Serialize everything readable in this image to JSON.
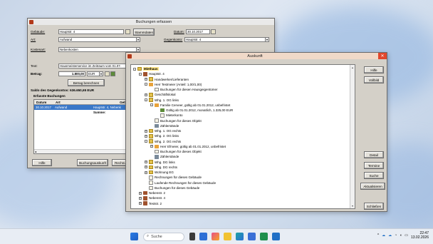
{
  "win1": {
    "title": "Buchungen erfassen",
    "fields": {
      "gebaeude_label": "Gebäude:",
      "gebaeude_value": "Hauptstr. 4",
      "stammdaten_btn": "Stammdaten",
      "datum_label": "Datum:",
      "datum_value": "30.10.2017",
      "art_label": "Art:",
      "art_value": "Aufwand",
      "gegenkonto_label": "Gegenkonto:",
      "gegenkonto_value": "Hauptstr. 4",
      "kostenart_label": "Kostenart:",
      "kostenart_value": "Nebenkosten",
      "text_label": "Text:",
      "text_value": "Hausmeisterservice im Zeitraum vom 01.07.",
      "betrag_label": "Betrag:",
      "betrag_value": "1.800,00",
      "currency": "EUR",
      "betrag_berechnen_btn": "Betrag berechnen",
      "saldo_text": "Saldo des Gegenkontos: 636.650,65 EUR"
    },
    "erfasste": {
      "heading": "Erfasste Buchungen",
      "columns": [
        "Datum",
        "Art",
        "Geb"
      ],
      "rows": [
        {
          "datum": "30.10.2017",
          "art": "Aufwand",
          "geb": "Hauptstr. 4, Nebenk"
        }
      ],
      "summe_label": "Summe:"
    },
    "buttons": {
      "hilfe": "Hilfe",
      "buchungsauskunft": "Buchungsauskunft",
      "rechnung": "Rechnu"
    }
  },
  "win2": {
    "title": "Auskunft",
    "tree": [
      {
        "depth": 0,
        "exp": "-",
        "icon": "folder",
        "label": "Miethaus",
        "highlight": true
      },
      {
        "depth": 1,
        "exp": "-",
        "icon": "house",
        "label": "Hauptstr. 4"
      },
      {
        "depth": 2,
        "exp": "+",
        "icon": "folder",
        "label": "Handwerker/Lieferanten"
      },
      {
        "depth": 2,
        "exp": "-",
        "icon": "person",
        "label": "Herr Testmeier (Anteil: 1,00/1,00)"
      },
      {
        "depth": 3,
        "exp": "",
        "icon": "doc",
        "label": "Buchungen für diesen Hausgeigentümer"
      },
      {
        "depth": 2,
        "exp": "+",
        "icon": "folder",
        "label": "Geschäftslokal"
      },
      {
        "depth": 2,
        "exp": "-",
        "icon": "folder",
        "label": "Whg. 1. OG links"
      },
      {
        "depth": 3,
        "exp": "-",
        "icon": "person",
        "label": "Familie Cerveer, gültig ab 01.01.2012, unbefristet"
      },
      {
        "depth": 4,
        "exp": "",
        "icon": "pen",
        "label": "Gültig ab 01.01.2012, monatlich, 1.325,00 EUR"
      },
      {
        "depth": 4,
        "exp": "",
        "icon": "doc",
        "label": "Mieterkonto"
      },
      {
        "depth": 3,
        "exp": "",
        "icon": "doc",
        "label": "Buchungen für dieses Objekt"
      },
      {
        "depth": 3,
        "exp": "",
        "icon": "meter",
        "label": "Zählerstände"
      },
      {
        "depth": 2,
        "exp": "+",
        "icon": "folder",
        "label": "Whg. 1. OG rechts"
      },
      {
        "depth": 2,
        "exp": "+",
        "icon": "folder",
        "label": "Whg. 2. OG links"
      },
      {
        "depth": 2,
        "exp": "-",
        "icon": "folder",
        "label": "Whg. 2. OG rechts"
      },
      {
        "depth": 3,
        "exp": "+",
        "icon": "person",
        "label": "Herr Efmeier, gültig ab 01.01.2012, unbefristet"
      },
      {
        "depth": 3,
        "exp": "",
        "icon": "doc",
        "label": "Buchungen für dieses Objekt"
      },
      {
        "depth": 3,
        "exp": "",
        "icon": "meter",
        "label": "Zählerstände"
      },
      {
        "depth": 2,
        "exp": "+",
        "icon": "folder",
        "label": "Whg. DG links"
      },
      {
        "depth": 2,
        "exp": "+",
        "icon": "folder",
        "label": "Whg. DG rechts"
      },
      {
        "depth": 2,
        "exp": "+",
        "icon": "folder",
        "label": "Wohnung EG"
      },
      {
        "depth": 2,
        "exp": "",
        "icon": "doc",
        "label": "Rechnungen für dieses Gebäude"
      },
      {
        "depth": 2,
        "exp": "",
        "icon": "doc",
        "label": "Laufende Rechnungen für dieses Gebäude"
      },
      {
        "depth": 2,
        "exp": "",
        "icon": "doc",
        "label": "Buchungen für dieses Gebäude"
      },
      {
        "depth": 1,
        "exp": "+",
        "icon": "house",
        "label": "Nebenstr. 2"
      },
      {
        "depth": 1,
        "exp": "+",
        "icon": "house",
        "label": "Nebenstr. 4"
      },
      {
        "depth": 1,
        "exp": "+",
        "icon": "house",
        "label": "Teststr. 2"
      }
    ],
    "buttons": {
      "hilfe": "Hilfe",
      "vollbild": "Vollbild",
      "detail": "Detail",
      "termine": "Termine",
      "suche": "Suche",
      "aktualisieren": "Aktualisieren",
      "schliessen": "Schließen"
    }
  },
  "taskbar": {
    "search_placeholder": "Suche",
    "time": "22:47",
    "date": "13.02.2026"
  }
}
